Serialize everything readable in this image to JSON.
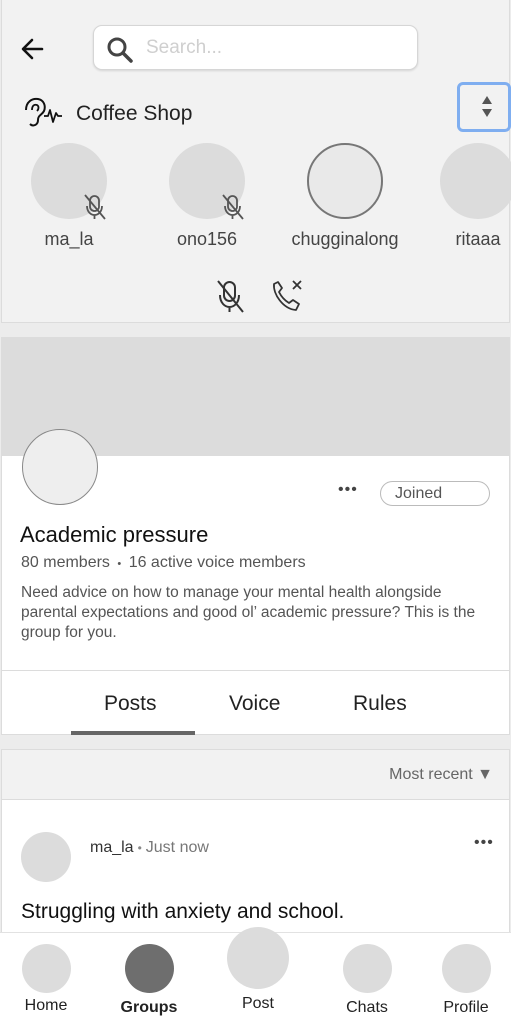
{
  "search": {
    "placeholder": "Search..."
  },
  "voice_room": {
    "title": "Coffee Shop",
    "speakers": [
      {
        "name": "ma_la",
        "muted": true
      },
      {
        "name": "ono156",
        "muted": true
      },
      {
        "name": "chugginalong",
        "muted": false,
        "speaking": true
      },
      {
        "name": "ritaaa",
        "muted": false
      }
    ]
  },
  "group": {
    "more_label": "•••",
    "joined_label": "Joined",
    "title": "Academic pressure",
    "members": "80 members",
    "meta_separator": "•",
    "active_voice": "16 active voice members",
    "description": "Need advice on how to manage your mental health alongside parental expectations and good ol’ academic pressure?  This is the group for you.",
    "tabs": [
      {
        "label": "Posts",
        "active": true
      },
      {
        "label": "Voice",
        "active": false
      },
      {
        "label": "Rules",
        "active": false
      }
    ]
  },
  "feed": {
    "sort_label": "Most recent ▼",
    "post": {
      "author": "ma_la",
      "separator": "•",
      "time": "Just now",
      "more_label": "•••",
      "title": "Struggling with anxiety and school."
    }
  },
  "nav": {
    "items": [
      {
        "label": "Home",
        "active": false
      },
      {
        "label": "Groups",
        "active": true
      },
      {
        "label": "Post",
        "active": false
      },
      {
        "label": "Chats",
        "active": false
      },
      {
        "label": "Profile",
        "active": false
      }
    ]
  },
  "colors": {
    "focus_ring": "#7faef0",
    "active_nav": "#6e6e6e",
    "placeholder_gray": "#dcdcdc"
  }
}
